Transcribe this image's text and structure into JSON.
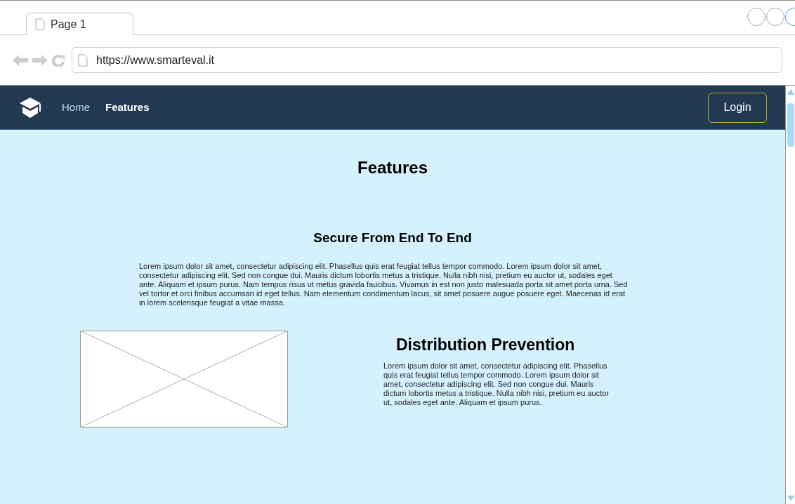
{
  "browser": {
    "tabs": [
      {
        "label": "Page 1",
        "selected": true
      }
    ],
    "url": "https://www.smarteval.it"
  },
  "navbar": {
    "items": [
      {
        "label": "Home",
        "selected": false
      },
      {
        "label": "Features",
        "selected": true
      }
    ],
    "login": "Login"
  },
  "page": {
    "title": "Features",
    "section_1": {
      "heading": "Secure From End To End",
      "text": "Lorem ipsum dolor sit amet, consectetur adipiscing elit. Phasellus quis erat feugiat tellus tempor commodo. Lorem ipsum dolor sit amet, consectetur adipiscing elit. Sed non congue dui. Mauris dictum lobortis metus a tristique. Nulla nibh nisi, pretium eu auctor ut, sodales eget ante. Aliquam et ipsum purus. Nam tempus risus ut metus gravida faucibus. Vivamus in est non justo malesuada porta sit amet porta urna.  Sed vel tortor et orci finibus accumsan id eget tellus. Nam elementum condimentum lacus, sit amet posuere augue posuere eget. Maecenas id erat in lorem scelerisque feugiat a vitae massa."
    },
    "section_2": {
      "heading": "Distribution Prevention",
      "text": "Lorem ipsum dolor sit amet, consectetur adipiscing elit. Phasellus quis erat feugiat tellus tempor commodo. Lorem ipsum dolor sit amet, consectetur adipiscing elit. Sed non congue dui. Mauris dictum lobortis metus a tristique. Nulla nibh nisi, pretium eu auctor ut, sodales eget ante. Aliquam et ipsum purus."
    }
  }
}
